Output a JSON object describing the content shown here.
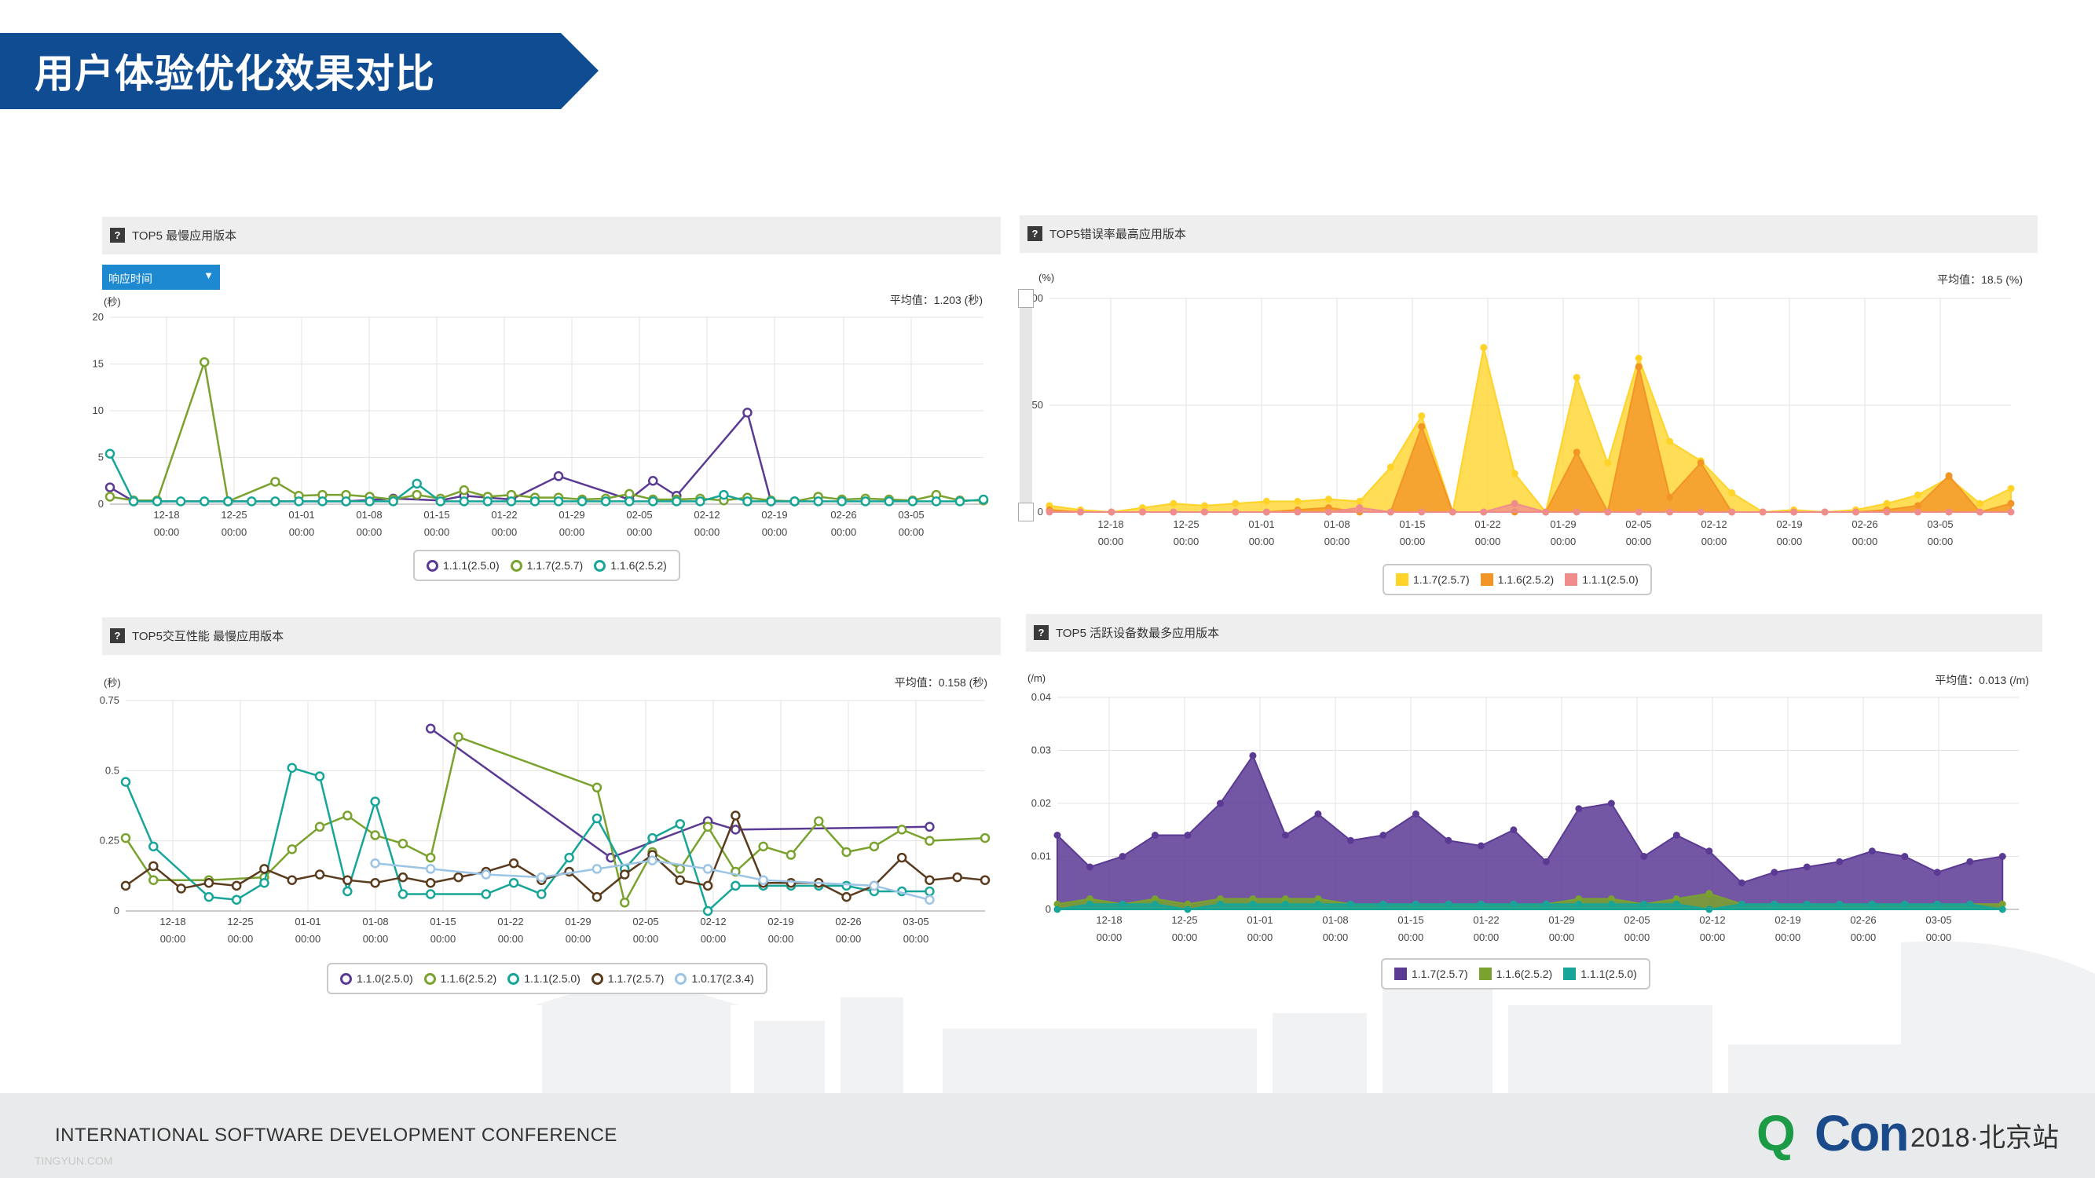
{
  "page_title": "用户体验优化效果对比",
  "footer": {
    "conference": "INTERNATIONAL SOFTWARE DEVELOPMENT CONFERENCE",
    "sub": "TINGYUN.COM",
    "logo_q": "Q",
    "logo_con": "Con",
    "logo_city": "2018·北京站"
  },
  "colors": {
    "banner": "#0f4c92",
    "purple": "#5b3a94",
    "green": "#7aa22e",
    "teal": "#17a598",
    "brown": "#5a3b1e",
    "lightblue": "#9cc4e4",
    "yellow": "#ffd327",
    "orange": "#f39426",
    "pink": "#ef8d8d"
  },
  "panels": {
    "p1": {
      "icon": "?",
      "title": "TOP5 最慢应用版本",
      "dropdown": "响应时间",
      "unit": "(秒)",
      "avg": "平均值：1.203 (秒)"
    },
    "p2": {
      "icon": "?",
      "title": "TOP5错误率最高应用版本",
      "unit": "(%)",
      "avg": "平均值：18.5 (%)"
    },
    "p3": {
      "icon": "?",
      "title": "TOP5交互性能 最慢应用版本",
      "unit": "(秒)",
      "avg": "平均值：0.158 (秒)"
    },
    "p4": {
      "icon": "?",
      "title": "TOP5 活跃设备数最多应用版本",
      "unit": "(/m)",
      "avg": "平均值：0.013 (/m)"
    }
  },
  "chart_data": [
    {
      "id": "slow-response",
      "type": "line",
      "ylim": [
        0,
        20
      ],
      "yticks": [
        0,
        5,
        10,
        15,
        20
      ],
      "ytick_labels": [
        "0",
        "5",
        "10",
        "15",
        "20"
      ],
      "x_count": 34,
      "xtick_labels": [
        [
          "12-18",
          "00:00"
        ],
        [
          "12-25",
          "00:00"
        ],
        [
          "01-01",
          "00:00"
        ],
        [
          "01-08",
          "00:00"
        ],
        [
          "01-15",
          "00:00"
        ],
        [
          "01-22",
          "00:00"
        ],
        [
          "01-29",
          "00:00"
        ],
        [
          "02-05",
          "00:00"
        ],
        [
          "02-12",
          "00:00"
        ],
        [
          "02-19",
          "00:00"
        ],
        [
          "02-26",
          "00:00"
        ],
        [
          "03-05",
          "00:00"
        ]
      ],
      "xtick_idx": [
        2,
        5,
        8,
        11,
        14,
        17,
        20,
        23,
        26,
        29,
        32,
        35
      ],
      "series": [
        {
          "name": "1.1.1(2.5.0)",
          "color": "#5b3a94",
          "x": [
            0,
            1,
            5,
            10,
            12,
            14,
            15,
            17,
            19,
            22,
            23,
            24,
            27,
            28,
            29
          ],
          "values": [
            1.8,
            0.3,
            0.3,
            0.3,
            0.6,
            0.4,
            0.9,
            0.5,
            3.0,
            0.5,
            2.5,
            0.9,
            9.8,
            0.3,
            0.3
          ]
        },
        {
          "name": "1.1.7(2.5.7)",
          "color": "#7aa22e",
          "x": [
            0,
            1,
            2,
            4,
            5,
            7,
            8,
            9,
            10,
            11,
            12,
            13,
            14,
            15,
            16,
            17,
            18,
            19,
            20,
            21,
            22,
            23,
            24,
            25,
            26,
            27,
            28,
            29,
            30,
            31,
            32,
            33,
            34,
            35,
            36,
            37
          ],
          "values": [
            0.8,
            0.4,
            0.4,
            15.2,
            0.3,
            2.4,
            0.9,
            1.0,
            1.0,
            0.8,
            0.5,
            1.0,
            0.6,
            1.5,
            0.8,
            1.0,
            0.7,
            0.7,
            0.5,
            0.6,
            1.1,
            0.5,
            0.5,
            0.6,
            0.4,
            0.7,
            0.4,
            0.3,
            0.8,
            0.5,
            0.6,
            0.5,
            0.4,
            1.0,
            0.4,
            0.4
          ]
        },
        {
          "name": "1.1.6(2.5.2)",
          "color": "#17a598",
          "x": [
            0,
            1,
            2,
            3,
            4,
            5,
            6,
            7,
            8,
            9,
            10,
            11,
            12,
            13,
            14,
            15,
            16,
            17,
            18,
            19,
            20,
            21,
            22,
            23,
            24,
            25,
            26,
            27,
            28,
            29,
            30,
            31,
            32,
            33,
            34,
            35,
            36,
            37
          ],
          "values": [
            5.4,
            0.3,
            0.3,
            0.3,
            0.3,
            0.3,
            0.3,
            0.3,
            0.3,
            0.3,
            0.3,
            0.3,
            0.3,
            2.2,
            0.3,
            0.3,
            0.3,
            0.3,
            0.3,
            0.3,
            0.3,
            0.3,
            0.3,
            0.3,
            0.3,
            0.3,
            1.0,
            0.3,
            0.3,
            0.3,
            0.3,
            0.3,
            0.3,
            0.3,
            0.3,
            0.3,
            0.3,
            0.5
          ]
        }
      ]
    },
    {
      "id": "error-rate",
      "type": "area",
      "ylim": [
        0,
        100
      ],
      "yticks": [
        0,
        50,
        100
      ],
      "ytick_labels": [
        "0",
        "50",
        "100"
      ],
      "xtick_labels": [
        [
          "12-18",
          "00:00"
        ],
        [
          "12-25",
          "00:00"
        ],
        [
          "01-01",
          "00:00"
        ],
        [
          "01-08",
          "00:00"
        ],
        [
          "01-15",
          "00:00"
        ],
        [
          "01-22",
          "00:00"
        ],
        [
          "01-29",
          "00:00"
        ],
        [
          "02-05",
          "00:00"
        ],
        [
          "02-12",
          "00:00"
        ],
        [
          "02-19",
          "00:00"
        ],
        [
          "02-26",
          "00:00"
        ],
        [
          "03-05",
          "00:00"
        ]
      ],
      "xtick_idx": [
        1.5,
        4,
        6.5,
        9,
        11.5,
        14,
        16.5,
        19,
        21.5,
        24,
        26.5,
        29
      ],
      "x_count": 31,
      "series": [
        {
          "name": "1.1.7(2.5.7)",
          "color": "#ffd327",
          "values": [
            3,
            1,
            0,
            2,
            4,
            3,
            4,
            5,
            5,
            6,
            5,
            21,
            45,
            0,
            77,
            18,
            0,
            63,
            23,
            72,
            33,
            24,
            9,
            0,
            1,
            0,
            1,
            4,
            8,
            16,
            4,
            11
          ]
        },
        {
          "name": "1.1.6(2.5.2)",
          "color": "#f39426",
          "values": [
            1,
            0,
            0,
            0,
            0,
            0,
            0,
            0,
            1,
            2,
            0,
            0,
            40,
            0,
            0,
            0,
            0,
            28,
            0,
            68,
            7,
            23,
            0,
            0,
            0,
            0,
            0,
            1,
            3,
            17,
            0,
            4
          ]
        },
        {
          "name": "1.1.1(2.5.0)",
          "color": "#ef8d8d",
          "values": [
            0,
            0,
            0,
            0,
            0,
            0,
            0,
            0,
            0,
            0,
            2,
            0,
            0,
            0,
            0,
            4,
            0,
            0,
            0,
            0,
            0,
            0,
            0,
            0,
            0,
            0,
            0,
            0,
            0,
            0,
            0,
            0
          ]
        }
      ]
    },
    {
      "id": "interaction",
      "type": "line",
      "ylim": [
        0,
        0.75
      ],
      "yticks": [
        0,
        0.25,
        0.5,
        0.75
      ],
      "ytick_labels": [
        "0",
        "0.25",
        "0.5",
        "0.75"
      ],
      "xtick_labels": [
        [
          "12-18",
          "00:00"
        ],
        [
          "12-25",
          "00:00"
        ],
        [
          "01-01",
          "00:00"
        ],
        [
          "01-08",
          "00:00"
        ],
        [
          "01-15",
          "00:00"
        ],
        [
          "01-22",
          "00:00"
        ],
        [
          "01-29",
          "00:00"
        ],
        [
          "02-05",
          "00:00"
        ],
        [
          "02-12",
          "00:00"
        ],
        [
          "02-19",
          "00:00"
        ],
        [
          "02-26",
          "00:00"
        ],
        [
          "03-05",
          "00:00"
        ]
      ],
      "xtick_idx": [
        1.5,
        4,
        6.5,
        9,
        11.5,
        14,
        16.5,
        19,
        21.5,
        24,
        26.5,
        29
      ],
      "x_count": 31,
      "series": [
        {
          "name": "1.1.0(2.5.0)",
          "color": "#5b3a94",
          "x": [
            11,
            17.5,
            21,
            22,
            29
          ],
          "values": [
            0.65,
            0.19,
            0.32,
            0.29,
            0.3
          ]
        },
        {
          "name": "1.1.6(2.5.2)",
          "color": "#7aa22e",
          "x": [
            0,
            1,
            3,
            5,
            6,
            7,
            8,
            9,
            10,
            11,
            12,
            17,
            18,
            19,
            20,
            21,
            22,
            23,
            24,
            25,
            26,
            27,
            28,
            29,
            31
          ],
          "values": [
            0.26,
            0.11,
            0.11,
            0.12,
            0.22,
            0.3,
            0.34,
            0.27,
            0.24,
            0.19,
            0.62,
            0.44,
            0.03,
            0.21,
            0.15,
            0.3,
            0.14,
            0.23,
            0.2,
            0.32,
            0.21,
            0.23,
            0.29,
            0.25,
            0.26
          ]
        },
        {
          "name": "1.1.1(2.5.0)",
          "color": "#17a598",
          "x": [
            0,
            1,
            3,
            4,
            5,
            6,
            7,
            8,
            9,
            10,
            11,
            13,
            14,
            15,
            16,
            17,
            18,
            19,
            20,
            21,
            22,
            23,
            24,
            25,
            26,
            27,
            28,
            29
          ],
          "values": [
            0.46,
            0.23,
            0.05,
            0.04,
            0.1,
            0.51,
            0.48,
            0.07,
            0.39,
            0.06,
            0.06,
            0.06,
            0.1,
            0.06,
            0.19,
            0.33,
            0.15,
            0.26,
            0.31,
            0.0,
            0.09,
            0.09,
            0.09,
            0.09,
            0.09,
            0.07,
            0.07,
            0.07
          ]
        },
        {
          "name": "1.1.7(2.5.7)",
          "color": "#5a3b1e",
          "x": [
            0,
            1,
            2,
            3,
            4,
            5,
            6,
            7,
            8,
            9,
            10,
            11,
            12,
            13,
            14,
            15,
            16,
            17,
            18,
            19,
            20,
            21,
            22,
            23,
            24,
            25,
            26,
            27,
            28,
            29,
            30,
            31
          ],
          "values": [
            0.09,
            0.16,
            0.08,
            0.1,
            0.09,
            0.15,
            0.11,
            0.13,
            0.11,
            0.1,
            0.12,
            0.1,
            0.12,
            0.14,
            0.17,
            0.11,
            0.14,
            0.05,
            0.13,
            0.2,
            0.11,
            0.09,
            0.34,
            0.1,
            0.1,
            0.1,
            0.05,
            0.09,
            0.19,
            0.11,
            0.12,
            0.11
          ]
        },
        {
          "name": "1.0.17(2.3.4)",
          "color": "#9cc4e4",
          "x": [
            9,
            11,
            13,
            15,
            17,
            19,
            21,
            23,
            27,
            29
          ],
          "values": [
            0.17,
            0.15,
            0.13,
            0.12,
            0.15,
            0.18,
            0.15,
            0.11,
            0.09,
            0.04
          ]
        }
      ]
    },
    {
      "id": "active-devices",
      "type": "area",
      "ylim": [
        0,
        0.04
      ],
      "yticks": [
        0,
        0.01,
        0.02,
        0.03,
        0.04
      ],
      "ytick_labels": [
        "0",
        "0.01",
        "0.02",
        "0.03",
        "0.04"
      ],
      "xtick_labels": [
        [
          "12-18",
          "00:00"
        ],
        [
          "12-25",
          "00:00"
        ],
        [
          "01-01",
          "00:00"
        ],
        [
          "01-08",
          "00:00"
        ],
        [
          "01-15",
          "00:00"
        ],
        [
          "01-22",
          "00:00"
        ],
        [
          "01-29",
          "00:00"
        ],
        [
          "02-05",
          "00:00"
        ],
        [
          "02-12",
          "00:00"
        ],
        [
          "02-19",
          "00:00"
        ],
        [
          "02-26",
          "00:00"
        ],
        [
          "03-05",
          "00:00"
        ]
      ],
      "xtick_idx": [
        1.5,
        4,
        6.5,
        9,
        11.5,
        14,
        16.5,
        19,
        21.5,
        24,
        26.5,
        29
      ],
      "x_count": 31,
      "series": [
        {
          "name": "1.1.7(2.5.7)",
          "color": "#5b3a94",
          "values": [
            0.014,
            0.008,
            0.01,
            0.014,
            0.014,
            0.02,
            0.029,
            0.014,
            0.018,
            0.013,
            0.014,
            0.018,
            0.013,
            0.012,
            0.015,
            0.009,
            0.019,
            0.02,
            0.01,
            0.014,
            0.011,
            0.005,
            0.007,
            0.008,
            0.009,
            0.011,
            0.01,
            0.007,
            0.009,
            0.01
          ]
        },
        {
          "name": "1.1.6(2.5.2)",
          "color": "#7aa22e",
          "values": [
            0.001,
            0.002,
            0.001,
            0.002,
            0.001,
            0.002,
            0.002,
            0.002,
            0.002,
            0.001,
            0.001,
            0.001,
            0.001,
            0.001,
            0.001,
            0.001,
            0.002,
            0.002,
            0.001,
            0.002,
            0.003,
            0.001,
            0.001,
            0.001,
            0.001,
            0.001,
            0.001,
            0.001,
            0.001,
            0.001
          ]
        },
        {
          "name": "1.1.1(2.5.0)",
          "color": "#17a598",
          "values": [
            0.0,
            0.001,
            0.001,
            0.001,
            0.0,
            0.001,
            0.001,
            0.001,
            0.001,
            0.001,
            0.001,
            0.001,
            0.001,
            0.001,
            0.001,
            0.001,
            0.001,
            0.001,
            0.001,
            0.001,
            0.0,
            0.001,
            0.001,
            0.001,
            0.001,
            0.001,
            0.001,
            0.001,
            0.001,
            0.0
          ]
        }
      ]
    }
  ]
}
